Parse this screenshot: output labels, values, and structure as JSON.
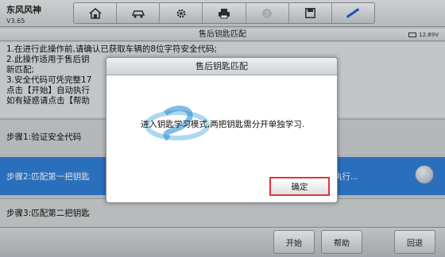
{
  "app": {
    "name": "东风风神",
    "version": "V3.65"
  },
  "toolbar": {
    "items": [
      "home-icon",
      "vehicle-icon",
      "gear-icon",
      "printer-icon",
      "help-icon",
      "save-icon",
      "pen-icon"
    ]
  },
  "header": {
    "title": "售后钥匙匹配",
    "battery": "12.89V"
  },
  "info": {
    "lines": [
      "1.在进行此操作前,请确认已获取车辆的8位字符安全代码;",
      "2.此操作适用于售后钥",
      "新匹配;",
      "3.安全代码可凭完整17",
      "点击【开始】自动执行",
      "如有疑惑请点击【帮助"
    ]
  },
  "steps": [
    {
      "label": "步骤1:验证安全代码"
    },
    {
      "label": "步骤2:匹配第一把钥匙",
      "trail": "执行..."
    },
    {
      "label": "步骤3:匹配第二把钥匙"
    }
  ],
  "buttons": {
    "start": "开始",
    "help": "帮助",
    "back": "回退"
  },
  "dialog": {
    "title": "售后钥匙匹配",
    "message": "进入钥匙学习模式,两把钥匙需分开单独学习.",
    "ok": "确定"
  },
  "colors": {
    "accent": "#2f7fd7",
    "highlight_border": "#e0363b"
  }
}
